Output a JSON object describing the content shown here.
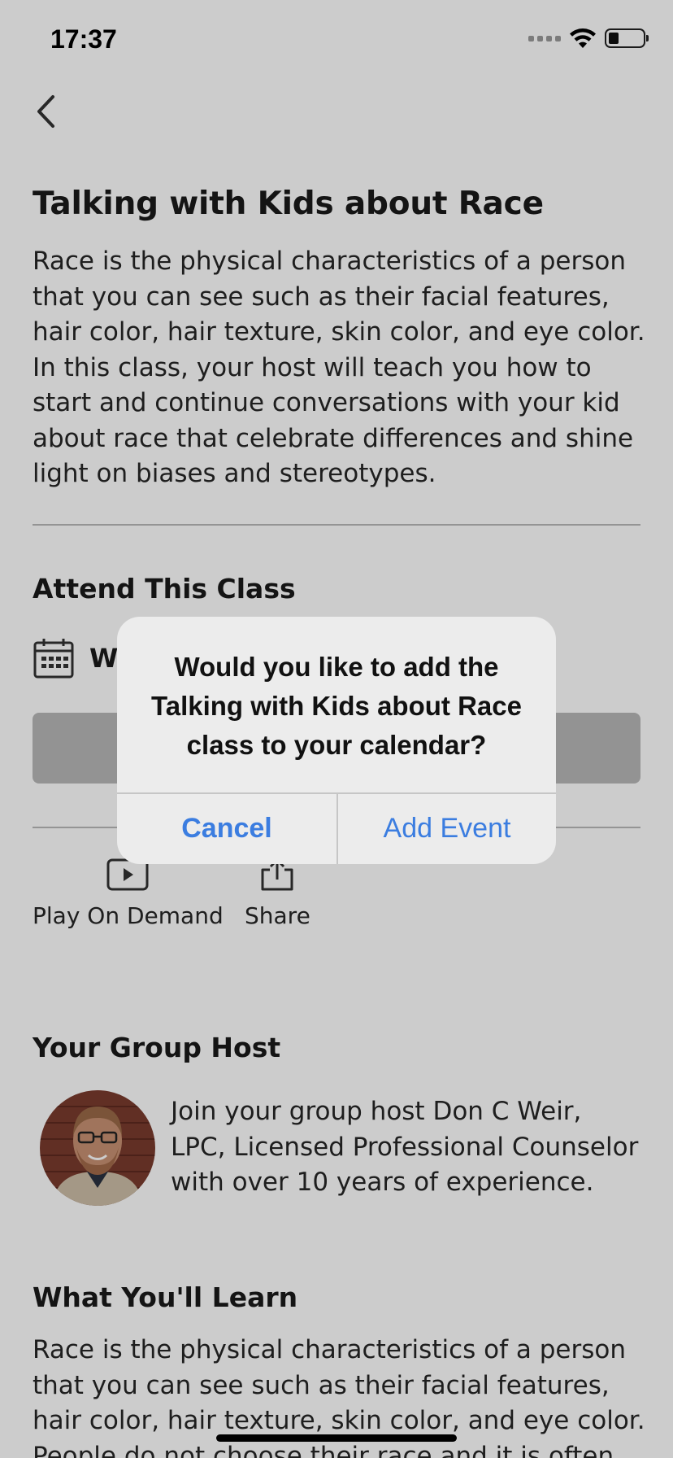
{
  "status_bar": {
    "time": "17:37"
  },
  "nav": {
    "back_icon": "chevron-left-icon"
  },
  "class": {
    "title": "Talking with Kids about Race",
    "description": "Race is the physical characteristics of a person that you can see such as their facial features, hair color, hair texture, skin color, and eye color. In this class, your host will teach you how to start and continue conversations with your kid about race that celebrate differences and shine light on biases and stereotypes."
  },
  "attend": {
    "heading": "Attend This Class",
    "date_visible": "W",
    "calendar_icon": "calendar-icon"
  },
  "actions": [
    {
      "label": "Play On Demand",
      "icon": "play-icon"
    },
    {
      "label": "Share",
      "icon": "share-icon"
    }
  ],
  "host": {
    "heading": "Your Group Host",
    "text": "Join your group host Don C Weir, LPC, Licensed Professional Counselor with over 10 years of experience."
  },
  "learn": {
    "heading": "What You'll Learn",
    "text": "Race is the physical characteristics of a person that you can see such as their facial features, hair color, hair texture, skin color, and eye color. People do not choose their race and it is often"
  },
  "alert": {
    "message": "Would you like to add the Talking with Kids about Race class to your calendar?",
    "cancel_label": "Cancel",
    "add_label": "Add Event",
    "button_color": "#3b7de0"
  }
}
